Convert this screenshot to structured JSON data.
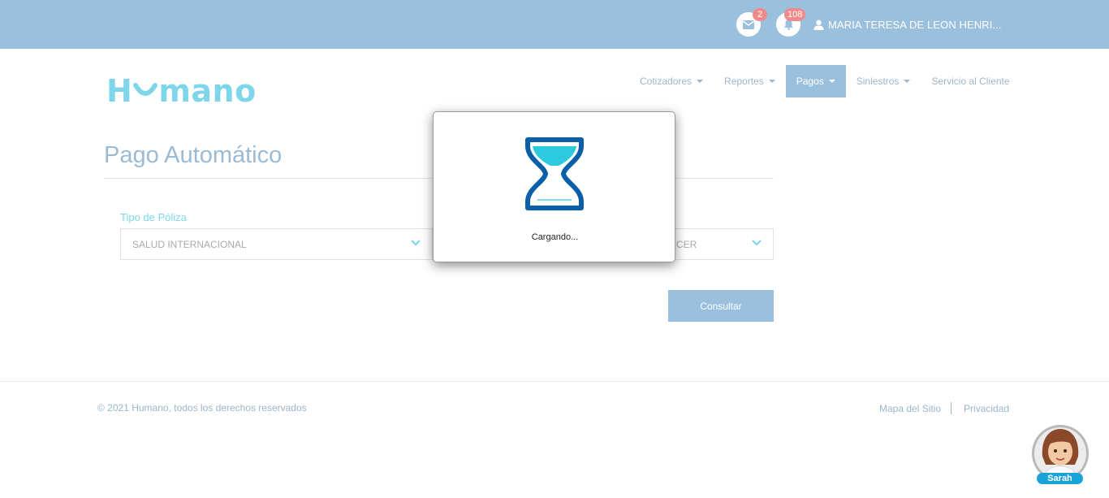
{
  "header": {
    "messages_badge": "2",
    "notifications_badge": "108",
    "user_name": "MARIA TERESA DE LEON HENRI..."
  },
  "brand": {
    "logo_text_left": "H",
    "logo_text_right": "mano"
  },
  "nav": {
    "items": [
      {
        "label": "Cotizadores",
        "has_caret": true
      },
      {
        "label": "Reportes",
        "has_caret": true
      },
      {
        "label": "Pagos",
        "has_caret": true,
        "active": true
      },
      {
        "label": "Siniestros",
        "has_caret": true
      },
      {
        "label": "Servicio al Cliente",
        "has_caret": false
      }
    ]
  },
  "main": {
    "title": "Pago Automático",
    "policy_type_label": "Tipo de Póliza",
    "policy_type_value": "SALUD INTERNACIONAL",
    "second_select_value": "CER",
    "consult_button": "Consultar"
  },
  "footer": {
    "copyright": "© 2021 Humano, todos los derechos reservados",
    "sitemap_link": "Mapa del Sitio",
    "privacy_link": "Privacidad"
  },
  "modal": {
    "loading_text": "Cargando..."
  },
  "assistant": {
    "name": "Sarah"
  },
  "colors": {
    "topbar": "#9bc0dd",
    "brand": "#7fd6ea",
    "badge": "#f08a8a",
    "hourglass_frame": "#0a5fa8",
    "hourglass_sand": "#2cc9df"
  },
  "icons": [
    "mail-icon",
    "bell-icon",
    "user-icon",
    "chevron-down-icon",
    "hourglass-icon",
    "assistant-avatar"
  ]
}
